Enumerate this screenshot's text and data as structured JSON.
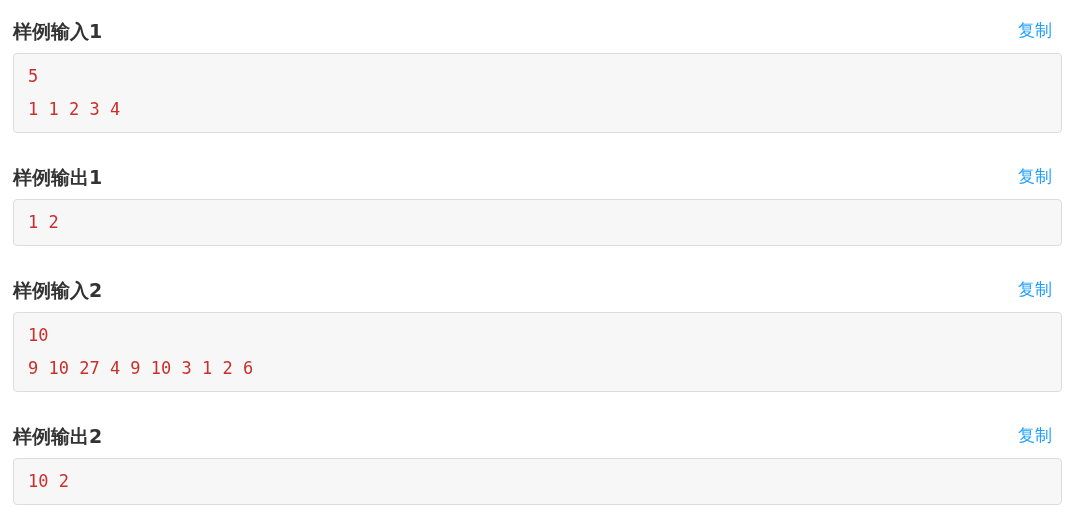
{
  "samples": [
    {
      "title": "样例输入1",
      "copy": "复制",
      "lines": [
        "5",
        "1 1 2 3 4"
      ]
    },
    {
      "title": "样例输出1",
      "copy": "复制",
      "lines": [
        "1 2"
      ]
    },
    {
      "title": "样例输入2",
      "copy": "复制",
      "lines": [
        "10",
        "9 10 27 4 9 10 3 1 2 6"
      ]
    },
    {
      "title": "样例输出2",
      "copy": "复制",
      "lines": [
        "10 2"
      ]
    }
  ]
}
